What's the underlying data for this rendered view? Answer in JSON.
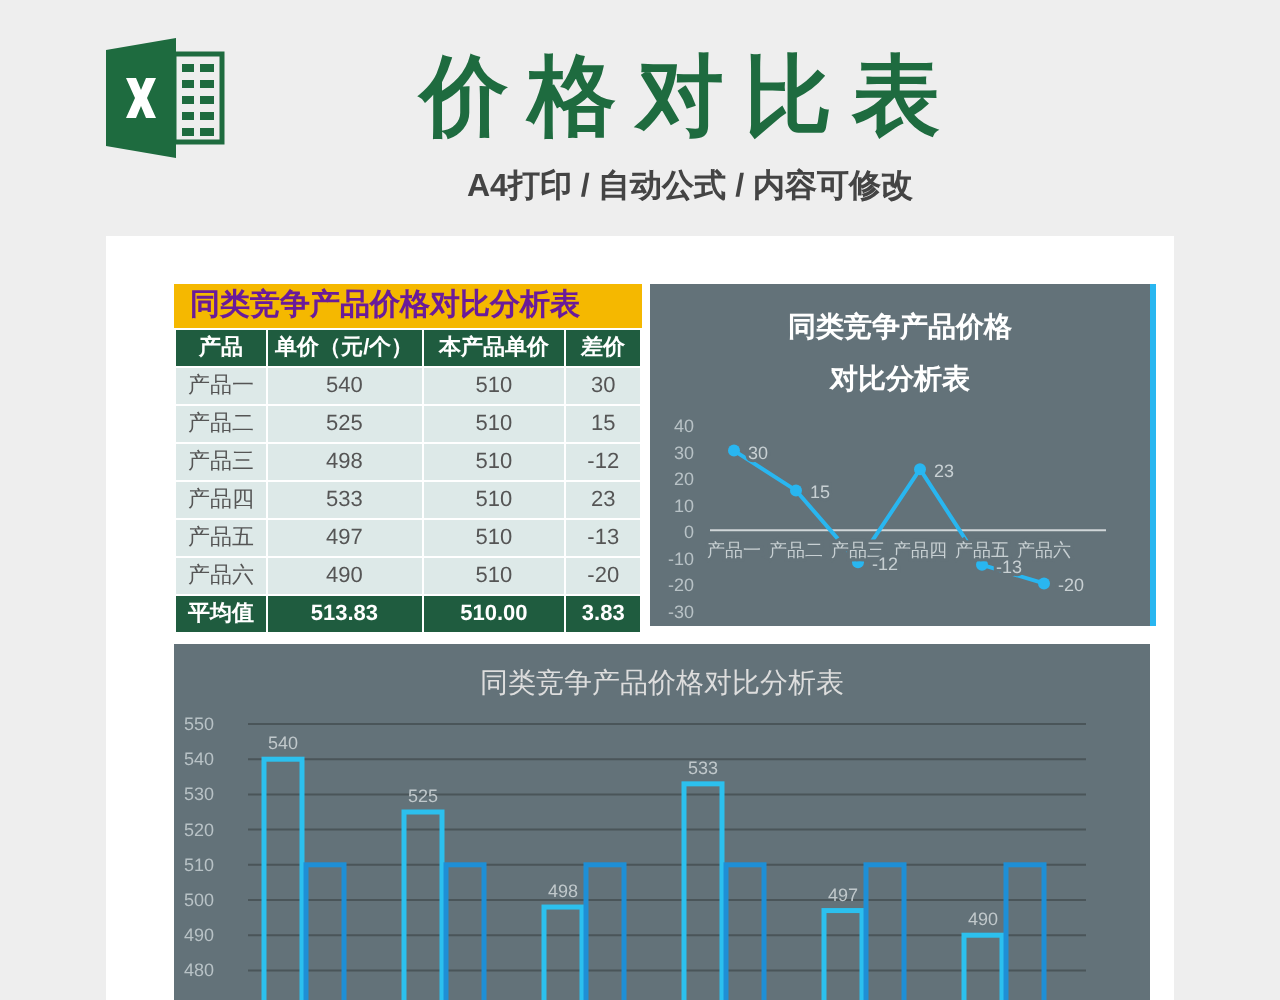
{
  "header": {
    "title": "价格对比表",
    "subtitle": "A4打印 / 自动公式 / 内容可修改"
  },
  "table": {
    "title": "同类竞争产品价格对比分析表",
    "columns": [
      "产品",
      "单价（元/个）",
      "本产品单价",
      "差价"
    ],
    "rows": [
      [
        "产品一",
        "540",
        "510",
        "30"
      ],
      [
        "产品二",
        "525",
        "510",
        "15"
      ],
      [
        "产品三",
        "498",
        "510",
        "-12"
      ],
      [
        "产品四",
        "533",
        "510",
        "23"
      ],
      [
        "产品五",
        "497",
        "510",
        "-13"
      ],
      [
        "产品六",
        "490",
        "510",
        "-20"
      ]
    ],
    "footer": [
      "平均值",
      "513.83",
      "510.00",
      "3.83"
    ]
  },
  "line_chart": {
    "chart_data": {
      "type": "line",
      "title": "同类竞争产品价格对比分析表",
      "categories": [
        "产品一",
        "产品二",
        "产品三",
        "产品四",
        "产品五",
        "产品六"
      ],
      "series": [
        {
          "color": "#29b6f0",
          "marker": "circle",
          "values": [
            30,
            15,
            -12,
            23,
            -13,
            -20
          ]
        }
      ],
      "yticks": [
        -30,
        -20,
        -10,
        0,
        10,
        20,
        30,
        40
      ],
      "ylim": [
        -30,
        40
      ],
      "data_labels": true
    }
  },
  "bar_chart": {
    "chart_data": {
      "type": "bar",
      "title": "同类竞争产品价格对比分析表",
      "grid": true,
      "series": [
        {
          "color": "#2cc0ee",
          "values": [
            540,
            525,
            498,
            533,
            497,
            490
          ]
        },
        {
          "color": "#1e8fd6",
          "values": [
            510,
            510,
            510,
            510,
            510,
            510
          ]
        }
      ],
      "yticks": [
        480,
        490,
        500,
        510,
        520,
        530,
        540,
        550
      ],
      "ylim": [
        470,
        550
      ],
      "value_labels": [
        "540",
        "525",
        "498",
        "533",
        "497",
        "490"
      ]
    }
  }
}
